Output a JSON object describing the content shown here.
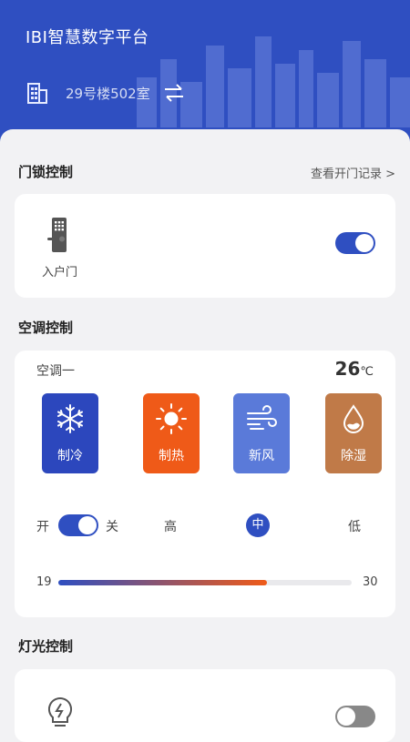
{
  "header": {
    "app_title": "IBI智慧数字平台",
    "room": "29号楼502室",
    "icons": [
      "building-icon",
      "swap-icon"
    ]
  },
  "door_section": {
    "title": "门锁控制",
    "link": "查看开门记录 >",
    "door_label": "入户门",
    "door_on": true
  },
  "ac_section": {
    "title": "空调控制",
    "unit_name": "空调一",
    "temp_value": "26",
    "temp_unit": "℃",
    "modes": [
      {
        "label": "制冷",
        "icon": "snowflake-icon",
        "color": "#2c47bd"
      },
      {
        "label": "制热",
        "icon": "sun-icon",
        "color": "#ef5a18"
      },
      {
        "label": "新风",
        "icon": "wind-icon",
        "color": "#5a7ad9"
      },
      {
        "label": "除湿",
        "icon": "droplet-icon",
        "color": "#c07a48"
      }
    ],
    "power_on_label": "开",
    "power_off_label": "关",
    "power_on": true,
    "speed_high": "高",
    "speed_mid": "中",
    "speed_low": "低",
    "speed_selected": "中",
    "range_min": "19",
    "range_max": "30",
    "slider_fraction": 0.71
  },
  "light_section": {
    "title": "灯光控制",
    "light_on": false
  },
  "colors": {
    "primary": "#2f4fc1",
    "heat": "#ef5a18",
    "background": "#f2f2f4"
  }
}
